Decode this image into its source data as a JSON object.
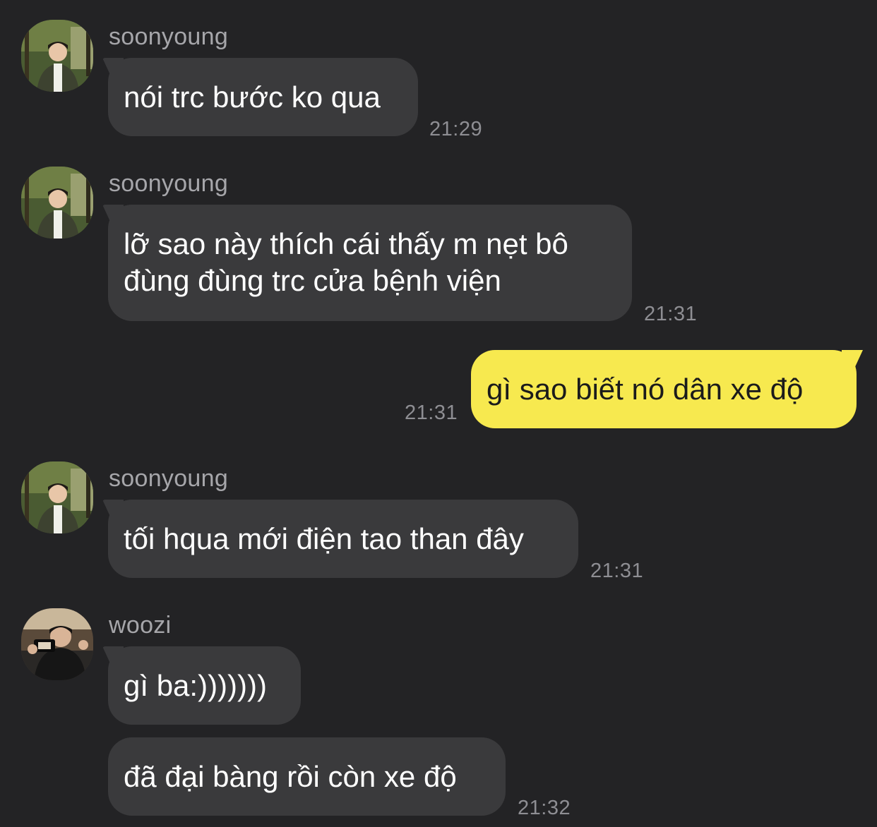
{
  "messages": [
    {
      "sender": "soonyoung",
      "avatar": "soonyoung-avatar",
      "text": "nói trc bước ko qua",
      "time": "21:29"
    },
    {
      "sender": "soonyoung",
      "avatar": "soonyoung-avatar",
      "text_line1": "lỡ sao này thích cái thấy m nẹt bô",
      "text_line2": "đùng đùng trc cửa bệnh viện",
      "time": "21:31"
    },
    {
      "sender": "me",
      "text": "gì sao biết nó dân xe độ",
      "time": "21:31"
    },
    {
      "sender": "soonyoung",
      "avatar": "soonyoung-avatar",
      "text": "tối hqua mới điện tao than đây",
      "time": "21:31"
    },
    {
      "sender": "woozi",
      "avatar": "woozi-avatar",
      "text": "gì ba:)))))))",
      "text2": "đã đại bàng rồi còn xe độ",
      "time": "21:32"
    }
  ],
  "colors": {
    "background": "#232325",
    "incoming_bubble": "#3a3a3c",
    "outgoing_bubble": "#f7e94f",
    "timestamp": "#8e8e93",
    "sender_name": "#a6a6aa"
  }
}
